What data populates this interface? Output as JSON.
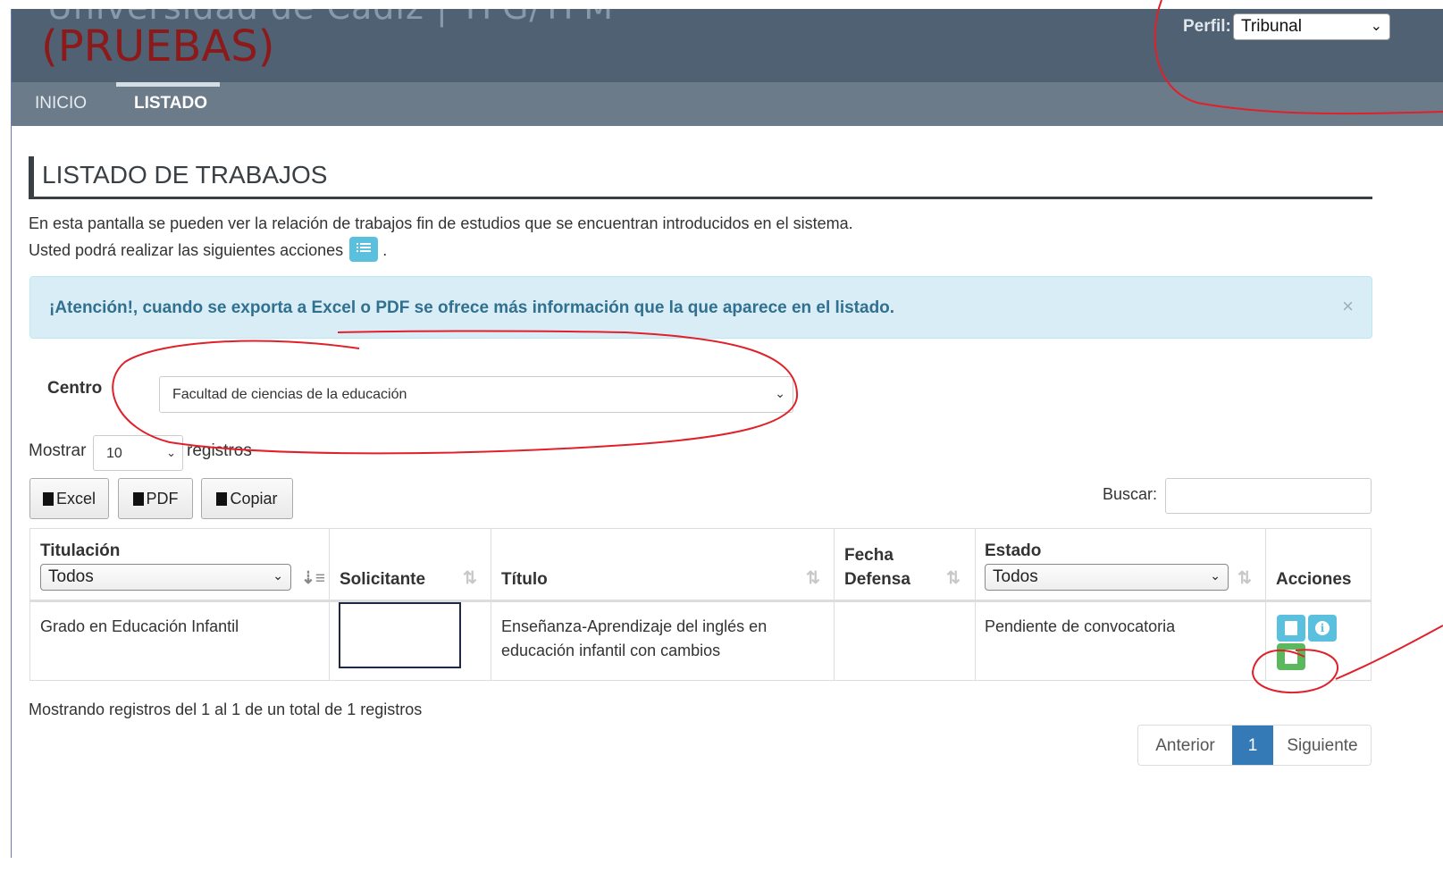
{
  "header": {
    "brand_top": "Universidad de Cádiz | TFG/TFM",
    "environment_label": "(PRUEBAS)",
    "profile_label": "Perfil:",
    "profile_selected": "Tribunal"
  },
  "nav": {
    "items": [
      {
        "label": "INICIO",
        "active": false
      },
      {
        "label": "LISTADO",
        "active": true
      }
    ]
  },
  "page": {
    "title": "LISTADO DE TRABAJOS",
    "description_line1": "En esta pantalla se pueden ver la relación de trabajos fin de estudios que se encuentran introducidos en el sistema.",
    "description_line2": "Usted podrá realizar las siguientes acciones",
    "description_end": "."
  },
  "alert": {
    "text": "¡Atención!, cuando se exporta a Excel o PDF se ofrece más información que la que aparece en el listado.",
    "close": "×"
  },
  "filters": {
    "centro_label": "Centro",
    "centro_selected": "Facultad de ciencias de la educación",
    "mostrar_label": "Mostrar",
    "mostrar_selected": "10",
    "registros_label": "registros",
    "buscar_label": "Buscar:"
  },
  "export_buttons": {
    "excel": "Excel",
    "pdf": "PDF",
    "copiar": "Copiar"
  },
  "table": {
    "columns": {
      "titulacion": "Titulación",
      "titulacion_filter": "Todos",
      "solicitante": "Solicitante",
      "titulo": "Título",
      "fecha_line1": "Fecha",
      "fecha_line2": "Defensa",
      "estado": "Estado",
      "estado_filter": "Todos",
      "acciones": "Acciones"
    },
    "rows": [
      {
        "titulacion": "Grado en Educación Infantil",
        "solicitante": "",
        "titulo_line1": "Enseñanza-Aprendizaje del inglés en",
        "titulo_line2": "educación infantil con cambios",
        "fecha_defensa": "",
        "estado": "Pendiente de convocatoria"
      }
    ]
  },
  "footer": {
    "info": "Mostrando registros del 1 al 1 de un total de 1 registros",
    "pagination": {
      "prev": "Anterior",
      "current": "1",
      "next": "Siguiente"
    }
  },
  "colors": {
    "header_bg": "#4f6172",
    "nav_bg": "#6b7b8a",
    "alert_bg": "#d9edf7",
    "primary": "#337ab7",
    "info_button": "#5bc0de",
    "success_button": "#5cb85c",
    "annotation": "#e0202a"
  },
  "icons": {
    "list": "list-icon",
    "excel": "file-excel-icon",
    "pdf": "file-pdf-icon",
    "copy": "copy-icon",
    "info": "info-circle-icon",
    "document": "document-icon",
    "file_export": "file-export-icon"
  }
}
